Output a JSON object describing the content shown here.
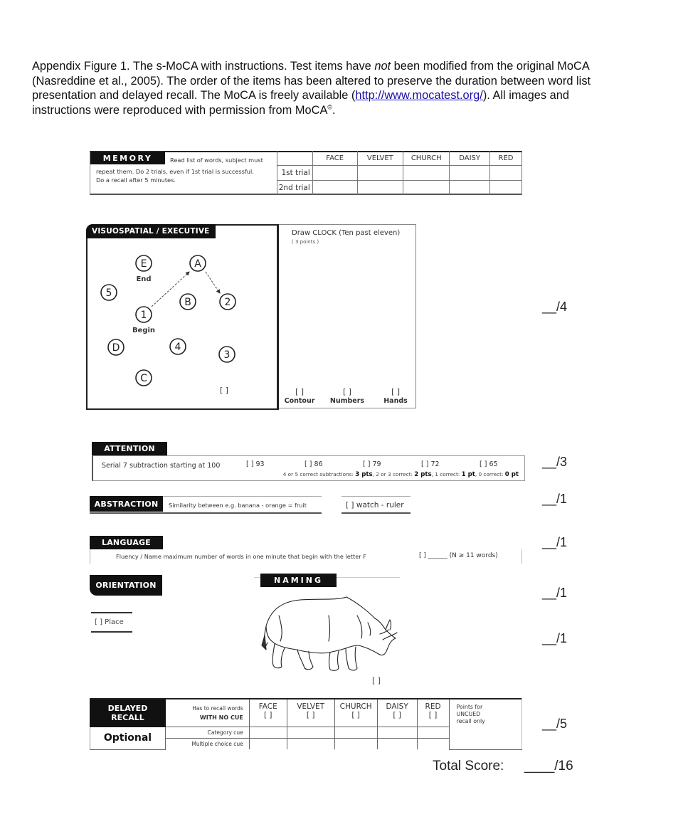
{
  "caption": {
    "part1": "Appendix Figure 1. The s-MoCA with instructions. Test items have ",
    "emphasis": "not",
    "part2": " been modified from the original MoCA (Nasreddine et al., 2005). The order of the items has been altered to preserve the duration between word list presentation and delayed recall. The MoCA is freely available (",
    "link": "http://www.mocatest.org/",
    "part3": ").  All images and instructions were reproduced with permission from MoCA",
    "sup": "©",
    "part4": "."
  },
  "memory": {
    "title": "MEMORY",
    "instr_line1": "Read list of words, subject must",
    "instr_line2": "repeat them. Do 2 trials, even if 1st  trial is successful.",
    "instr_line3": "Do a recall after 5 minutes.",
    "words": [
      "FACE",
      "VELVET",
      "CHURCH",
      "DAISY",
      "RED"
    ],
    "trials": [
      "1st trial",
      "2nd trial"
    ]
  },
  "visuospatial": {
    "title": "VISUOSPATIAL / EXECUTIVE",
    "trail_nodes": [
      {
        "label": "E",
        "sub": "End"
      },
      {
        "label": "A"
      },
      {
        "label": "5"
      },
      {
        "label": "B"
      },
      {
        "label": "2"
      },
      {
        "label": "1",
        "sub": "Begin"
      },
      {
        "label": "D"
      },
      {
        "label": "4"
      },
      {
        "label": "3"
      },
      {
        "label": "C"
      }
    ],
    "trail_checkbox": "[    ]",
    "clock_title": "Draw CLOCK  (Ten past eleven)",
    "clock_points": "( 3 points )",
    "clock_criteria": [
      "Contour",
      "Numbers",
      "Hands"
    ],
    "checkbox": "[    ]",
    "score": "__/4"
  },
  "attention": {
    "title": "ATTENTION",
    "instruction": "Serial 7 subtraction starting at 100",
    "items": [
      "[  ] 93",
      "[  ] 86",
      "[  ] 79",
      "[  ] 72",
      "[  ] 65"
    ],
    "rule_1": "4 or 5 correct subtractions:  ",
    "rule_1b": "3 pts",
    "rule_2": ", 2 or 3 correct:  ",
    "rule_2b": "2 pts",
    "rule_3": ", 1 correct:  ",
    "rule_3b": "1 pt",
    "rule_4": ", 0 correct:  ",
    "rule_4b": "0 pt",
    "score": "__/3"
  },
  "abstraction": {
    "title": "ABSTRACTION",
    "instruction": "Similarity between e.g. banana - orange = fruit",
    "item": "[   ]  watch - ruler",
    "score": "__/1"
  },
  "language": {
    "title": "LANGUAGE",
    "instruction": "Fluency / Name maximum number of words in one minute that begin with the letter F",
    "answer": "[    ]  ______  (N ≥ 11 words)",
    "score": "__/1"
  },
  "orientation": {
    "title": "ORIENTATION",
    "item": "[   ]  Place",
    "score": "__/1"
  },
  "naming": {
    "title": "NAMING",
    "checkbox": "[ ]",
    "score": "__/1"
  },
  "delayed_recall": {
    "title": "DELAYED RECALL",
    "optional": "Optional",
    "row1_label_a": "Has to recall words",
    "row1_label_b": "WITH NO CUE",
    "row2_label": "Category cue",
    "row3_label": "Multiple choice cue",
    "words": [
      "FACE",
      "VELVET",
      "CHURCH",
      "DAISY",
      "RED"
    ],
    "checkbox": "[  ]",
    "points_note_1": "Points for",
    "points_note_2": "UNCUED",
    "points_note_3": "recall only",
    "score": "__/5"
  },
  "total": {
    "label": "Total Score:",
    "value": "____/16"
  }
}
